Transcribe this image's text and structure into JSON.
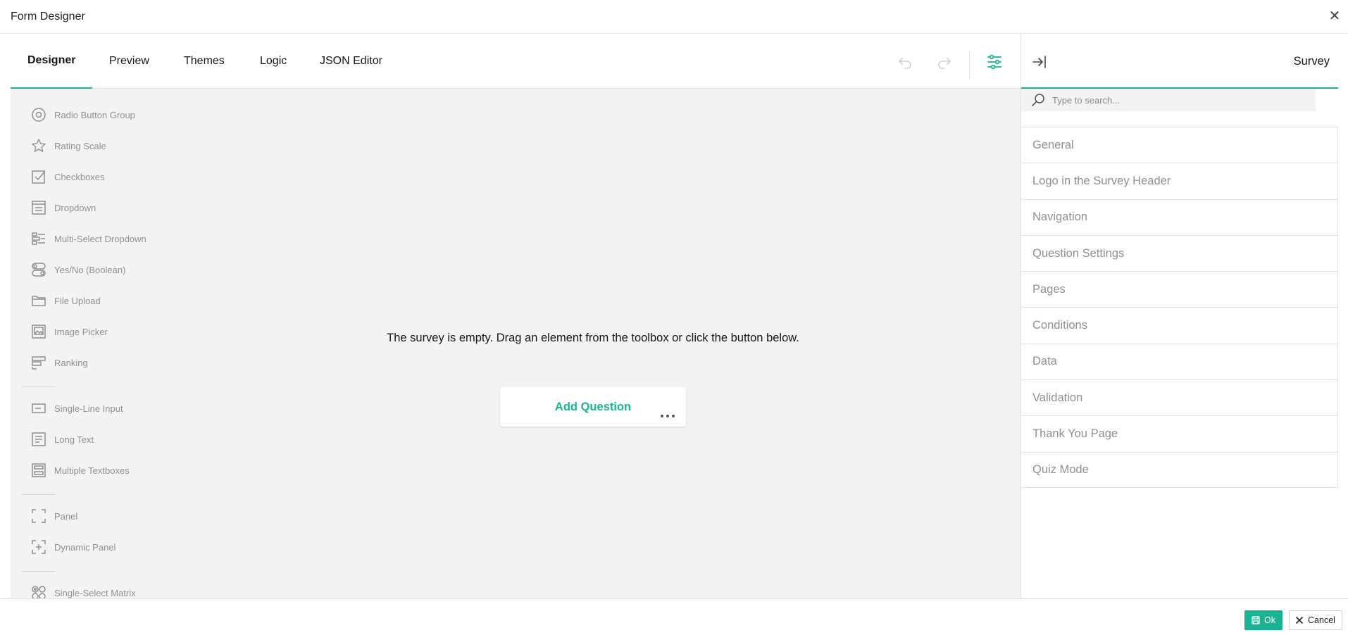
{
  "dialog": {
    "title": "Form Designer",
    "close_icon": "close-icon"
  },
  "tabs": [
    {
      "label": "Designer",
      "active": true
    },
    {
      "label": "Preview",
      "active": false
    },
    {
      "label": "Themes",
      "active": false
    },
    {
      "label": "Logic",
      "active": false
    },
    {
      "label": "JSON Editor",
      "active": false
    }
  ],
  "toolbar": {
    "undo_icon": "undo-icon",
    "redo_icon": "redo-icon",
    "settings_icon": "settings-sliders-icon"
  },
  "toolbox": {
    "items": [
      {
        "label": "Radio Button Group",
        "icon": "radio-icon"
      },
      {
        "label": "Rating Scale",
        "icon": "star-icon"
      },
      {
        "label": "Checkboxes",
        "icon": "checkbox-icon"
      },
      {
        "label": "Dropdown",
        "icon": "dropdown-icon"
      },
      {
        "label": "Multi-Select Dropdown",
        "icon": "multiselect-icon"
      },
      {
        "label": "Yes/No (Boolean)",
        "icon": "boolean-icon"
      },
      {
        "label": "File Upload",
        "icon": "folder-icon"
      },
      {
        "label": "Image Picker",
        "icon": "image-icon"
      },
      {
        "label": "Ranking",
        "icon": "ranking-icon"
      },
      {
        "label": "Single-Line Input",
        "icon": "input-icon"
      },
      {
        "label": "Long Text",
        "icon": "textarea-icon"
      },
      {
        "label": "Multiple Textboxes",
        "icon": "multitext-icon"
      },
      {
        "label": "Panel",
        "icon": "panel-icon"
      },
      {
        "label": "Dynamic Panel",
        "icon": "dynamic-panel-icon"
      },
      {
        "label": "Single-Select Matrix",
        "icon": "matrix-icon"
      }
    ]
  },
  "canvas": {
    "empty_message": "The survey is empty. Drag an element from the toolbox or click the button below.",
    "add_question_label": "Add Question"
  },
  "sidebar": {
    "title": "Survey",
    "search_placeholder": "Type to search...",
    "categories": [
      "General",
      "Logo in the Survey Header",
      "Navigation",
      "Question Settings",
      "Pages",
      "Conditions",
      "Data",
      "Validation",
      "Thank You Page",
      "Quiz Mode"
    ]
  },
  "footer": {
    "ok_label": "Ok",
    "cancel_label": "Cancel"
  },
  "colors": {
    "accent": "#19b394",
    "canvas_bg": "#f3f3f3",
    "muted_text": "#909090"
  }
}
